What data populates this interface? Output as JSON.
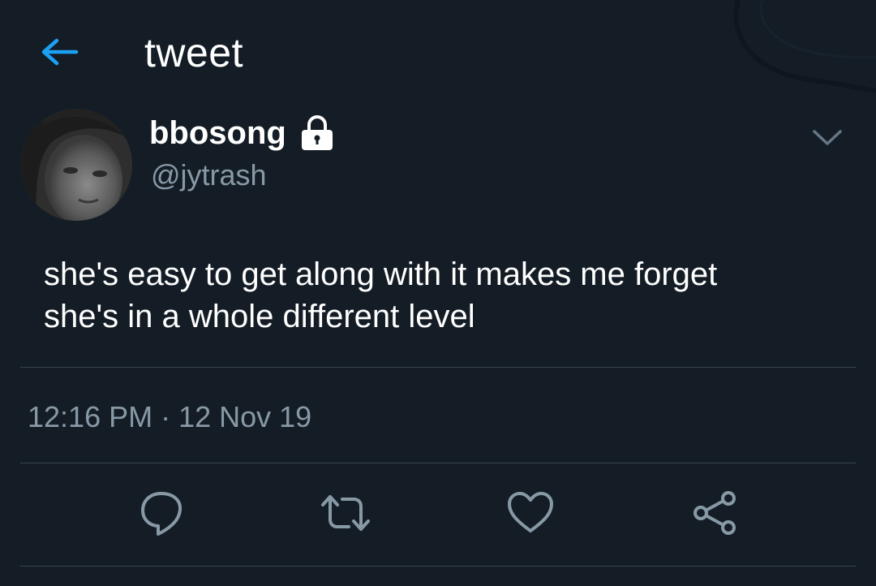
{
  "header": {
    "back_icon": "back-arrow-icon",
    "title": "tweet"
  },
  "tweet": {
    "author": {
      "display_name": "bbosong",
      "handle": "@jytrash",
      "protected_icon": "lock-icon",
      "avatar": "profile-photo"
    },
    "menu_icon": "chevron-down-icon",
    "text": "she's easy to get along with it makes me forget\nshe's in a whole different level",
    "timestamp": "12:16 PM · 12 Nov 19",
    "actions": [
      "reply-icon",
      "retweet-icon",
      "like-icon",
      "share-icon"
    ]
  },
  "colors": {
    "background": "#141d26",
    "accent": "#1da1f2",
    "secondary_text": "#8899a6",
    "divider": "#38444d",
    "icon": "#8899a6"
  }
}
